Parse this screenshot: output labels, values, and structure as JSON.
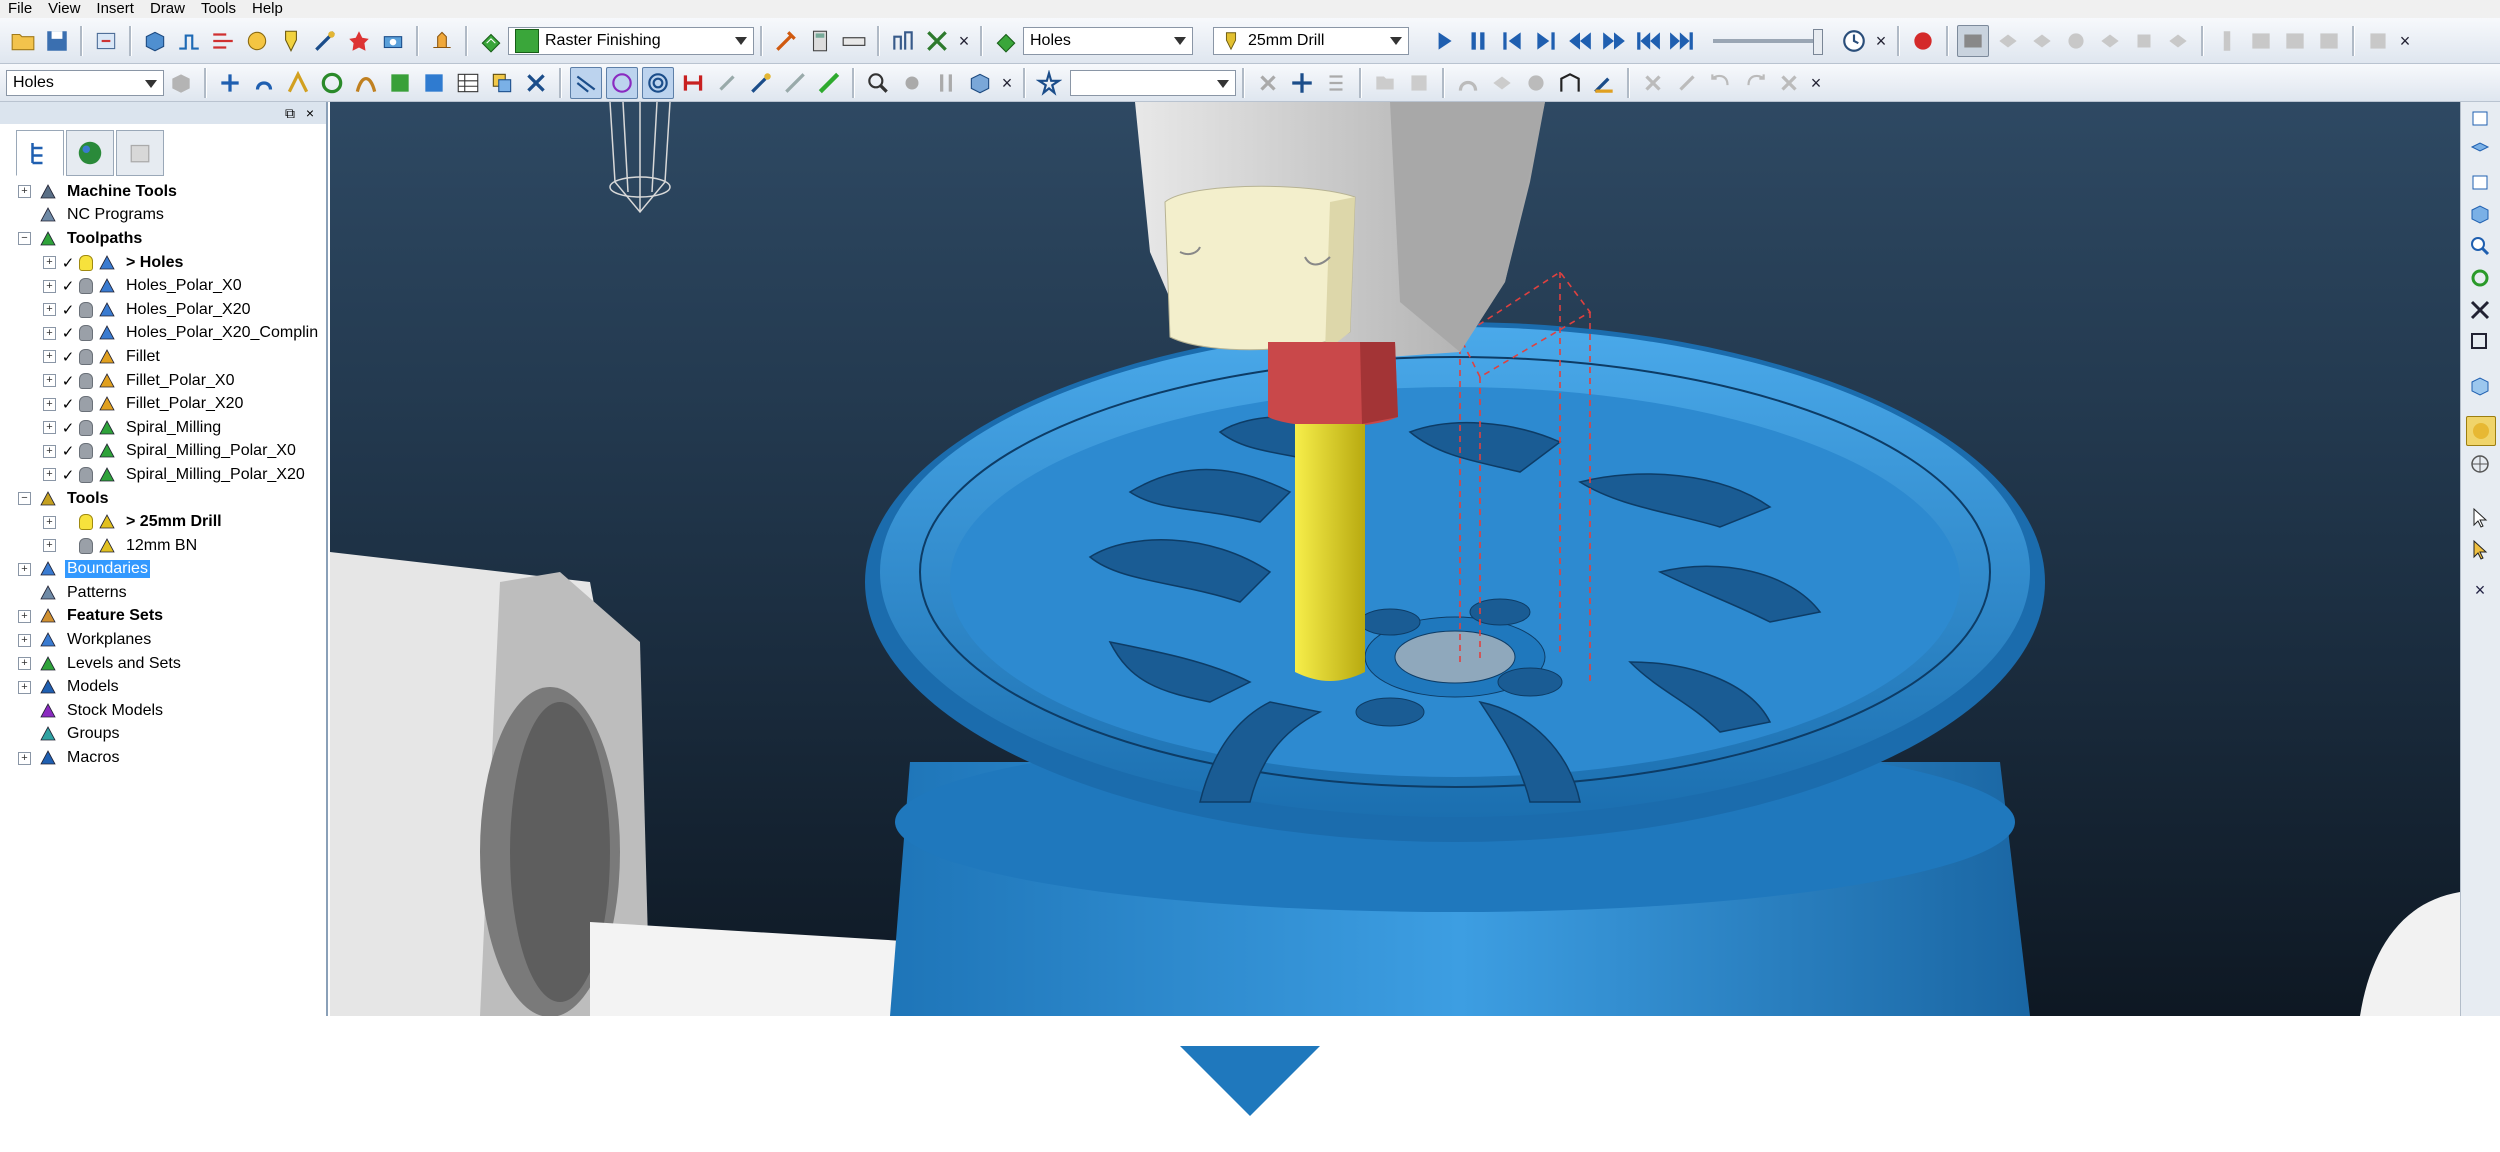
{
  "menu": [
    "File",
    "View",
    "Insert",
    "Draw",
    "Tools",
    "Help"
  ],
  "toolbar": {
    "strategy": "Raster Finishing",
    "toolpath": "Holes",
    "tool": "25mm Drill",
    "second_selector": "Holes",
    "empty_combo": ""
  },
  "explorer": {
    "tabs": [
      "explorer-tree-icon",
      "globe-icon",
      "database-icon"
    ],
    "nodes": [
      {
        "label": "Machine Tools",
        "bold": true,
        "level": 0,
        "exp": "+",
        "icon": "machine-tool-icon"
      },
      {
        "label": "NC Programs",
        "bold": false,
        "level": 0,
        "exp": "",
        "icon": "nc-program-icon"
      },
      {
        "label": "Toolpaths",
        "bold": true,
        "level": 0,
        "exp": "−",
        "icon": "toolpaths-icon"
      },
      {
        "label": "> Holes",
        "bold": true,
        "level": 1,
        "exp": "+",
        "check": true,
        "bulb": "on",
        "icon": "drill-toolpath-icon"
      },
      {
        "label": "Holes_Polar_X0",
        "bold": false,
        "level": 1,
        "exp": "+",
        "check": true,
        "bulb": "off",
        "icon": "drill-toolpath-icon"
      },
      {
        "label": "Holes_Polar_X20",
        "bold": false,
        "level": 1,
        "exp": "+",
        "check": true,
        "bulb": "off",
        "icon": "drill-toolpath-icon"
      },
      {
        "label": "Holes_Polar_X20_Complin",
        "bold": false,
        "level": 1,
        "exp": "+",
        "check": true,
        "bulb": "off",
        "icon": "drill-toolpath-icon"
      },
      {
        "label": "Fillet",
        "bold": false,
        "level": 1,
        "exp": "+",
        "check": true,
        "bulb": "off",
        "icon": "fillet-toolpath-icon"
      },
      {
        "label": "Fillet_Polar_X0",
        "bold": false,
        "level": 1,
        "exp": "+",
        "check": true,
        "bulb": "off",
        "icon": "fillet-toolpath-icon"
      },
      {
        "label": "Fillet_Polar_X20",
        "bold": false,
        "level": 1,
        "exp": "+",
        "check": true,
        "bulb": "off",
        "icon": "fillet-toolpath-icon"
      },
      {
        "label": "Spiral_Milling",
        "bold": false,
        "level": 1,
        "exp": "+",
        "check": true,
        "bulb": "off",
        "icon": "spiral-toolpath-icon"
      },
      {
        "label": "Spiral_Milling_Polar_X0",
        "bold": false,
        "level": 1,
        "exp": "+",
        "check": true,
        "bulb": "off",
        "icon": "spiral-toolpath-icon"
      },
      {
        "label": "Spiral_Milling_Polar_X20",
        "bold": false,
        "level": 1,
        "exp": "+",
        "check": true,
        "bulb": "off",
        "icon": "spiral-toolpath-icon"
      },
      {
        "label": "Tools",
        "bold": true,
        "level": 0,
        "exp": "−",
        "icon": "tools-icon"
      },
      {
        "label": "> 25mm Drill",
        "bold": true,
        "level": 1,
        "exp": "+",
        "bulb": "on",
        "icon": "drill-tool-icon"
      },
      {
        "label": "12mm BN",
        "bold": false,
        "level": 1,
        "exp": "+",
        "bulb": "off",
        "icon": "ballnose-tool-icon"
      },
      {
        "label": "Boundaries",
        "bold": false,
        "level": 0,
        "exp": "+",
        "selected": true,
        "icon": "boundary-icon"
      },
      {
        "label": "Patterns",
        "bold": false,
        "level": 0,
        "exp": "",
        "icon": "pattern-icon"
      },
      {
        "label": "Feature Sets",
        "bold": true,
        "level": 0,
        "exp": "+",
        "icon": "feature-set-icon"
      },
      {
        "label": "Workplanes",
        "bold": false,
        "level": 0,
        "exp": "+",
        "icon": "workplane-icon"
      },
      {
        "label": "Levels and Sets",
        "bold": false,
        "level": 0,
        "exp": "+",
        "icon": "levels-icon"
      },
      {
        "label": "Models",
        "bold": false,
        "level": 0,
        "exp": "+",
        "icon": "model-icon"
      },
      {
        "label": "Stock Models",
        "bold": false,
        "level": 0,
        "exp": "",
        "icon": "stock-model-icon"
      },
      {
        "label": "Groups",
        "bold": false,
        "level": 0,
        "exp": "",
        "icon": "group-icon"
      },
      {
        "label": "Macros",
        "bold": false,
        "level": 0,
        "exp": "+",
        "icon": "macro-icon"
      }
    ]
  },
  "colors": {
    "wheel": "#2e8fd6",
    "wheel_dark": "#1b6fb0",
    "spindle": "#c8c8c8",
    "holder": "#f3efcc",
    "collet": "#c9484a",
    "drill": "#e1d400",
    "background_top": "#2e4963",
    "background_bottom": "#0e1823",
    "selection": "#3399ff",
    "toolpath_red": "#e0413f"
  }
}
